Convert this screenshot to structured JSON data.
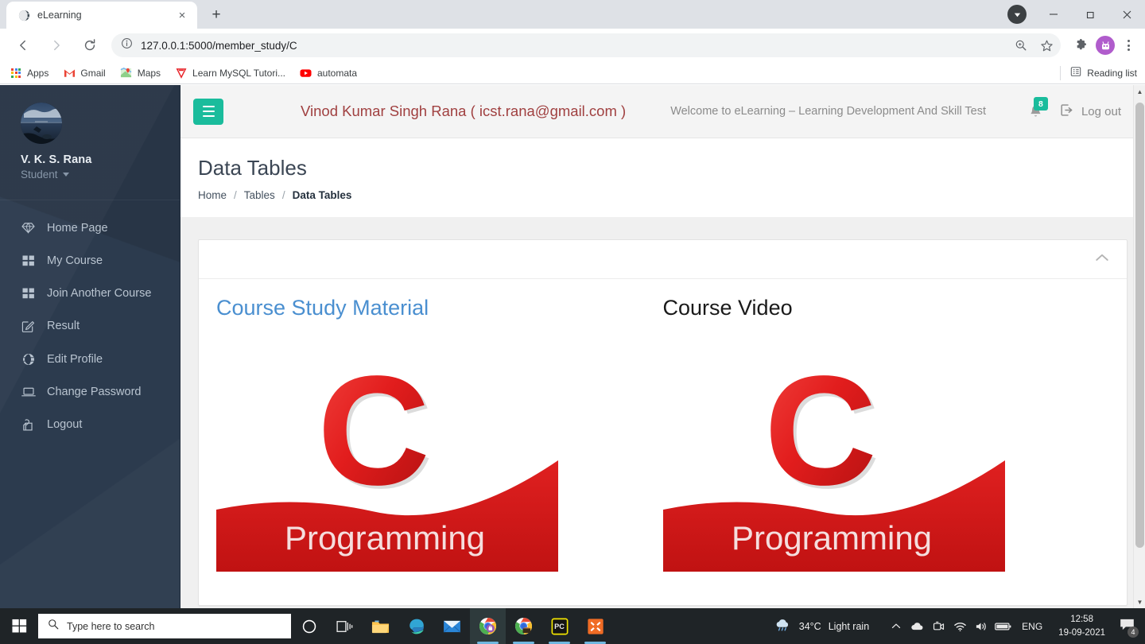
{
  "browser": {
    "tab": {
      "title": "eLearning",
      "favicon": "globe-icon",
      "close": "×"
    },
    "newtab_label": "+",
    "window_controls": {
      "minimize": "—",
      "maximize": "❐",
      "close": "✕"
    },
    "nav": {
      "back": "←",
      "forward": "→",
      "reload": "⟳"
    },
    "omnibox": {
      "url": "127.0.0.1:5000/member_study/C",
      "info_icon": "info-icon",
      "zoom_icon": "zoom-icon",
      "star_icon": "star-icon"
    },
    "extensions_icon": "puzzle-icon",
    "bookmarks": [
      {
        "label": "Apps",
        "icon": "apps-grid-icon"
      },
      {
        "label": "Gmail",
        "icon": "gmail-icon"
      },
      {
        "label": "Maps",
        "icon": "maps-icon"
      },
      {
        "label": "Learn MySQL Tutori...",
        "icon": "mysql-tutorial-icon"
      },
      {
        "label": "automata",
        "icon": "youtube-icon"
      }
    ],
    "reading_list": {
      "label": "Reading list",
      "icon": "reading-list-icon"
    }
  },
  "sidebar": {
    "user_name": "V. K. S. Rana",
    "role": "Student",
    "avatar_alt": "user-avatar",
    "items": [
      {
        "label": "Home Page",
        "icon": "diamond-icon"
      },
      {
        "label": "My Course",
        "icon": "grid-icon"
      },
      {
        "label": "Join Another Course",
        "icon": "grid-icon"
      },
      {
        "label": "Result",
        "icon": "edit-square-icon"
      },
      {
        "label": "Edit Profile",
        "icon": "globe-circle-icon"
      },
      {
        "label": "Change Password",
        "icon": "laptop-icon"
      },
      {
        "label": "Logout",
        "icon": "copy-icon"
      }
    ]
  },
  "topbar": {
    "menu_toggle": "hamburger-icon",
    "user_name": "Vinod Kumar Singh Rana",
    "user_email_wrapped": "(  icst.rana@gmail.com  )",
    "welcome": "Welcome to eLearning – Learning Development And Skill Test",
    "notification_count": "8",
    "logout_label": "Log out"
  },
  "page": {
    "title": "Data Tables",
    "breadcrumb": [
      {
        "label": "Home",
        "active": false
      },
      {
        "label": "Tables",
        "active": false
      },
      {
        "label": "Data Tables",
        "active": true
      }
    ],
    "separator": "/"
  },
  "card": {
    "collapse_icon": "chevron-up-icon",
    "columns": [
      {
        "title": "Course Study Material",
        "style": "link",
        "thumb_text": "Programming",
        "thumb_letter": "C"
      },
      {
        "title": "Course Video",
        "style": "plain",
        "thumb_text": "Programming",
        "thumb_letter": "C"
      }
    ]
  },
  "taskbar": {
    "start_icon": "windows-icon",
    "search_placeholder": "Type here to search",
    "search_icon": "search-icon",
    "icons": [
      {
        "name": "cortana-icon",
        "state": "idle"
      },
      {
        "name": "task-view-icon",
        "state": "idle"
      },
      {
        "name": "file-explorer-icon",
        "state": "idle"
      },
      {
        "name": "edge-icon",
        "state": "idle"
      },
      {
        "name": "mail-icon",
        "state": "idle"
      },
      {
        "name": "chrome-icon",
        "state": "active"
      },
      {
        "name": "chrome-icon",
        "state": "running"
      },
      {
        "name": "pycharm-icon",
        "state": "running"
      },
      {
        "name": "xampp-icon",
        "state": "running"
      }
    ],
    "weather": {
      "temperature": "34°C",
      "condition": "Light rain",
      "icon": "rain-cloud-icon"
    },
    "tray": [
      {
        "name": "show-hidden-icons",
        "glyph": "∧"
      },
      {
        "name": "onedrive-icon",
        "glyph": ""
      },
      {
        "name": "camera-icon",
        "glyph": ""
      },
      {
        "name": "wifi-icon",
        "glyph": ""
      },
      {
        "name": "volume-icon",
        "glyph": ""
      },
      {
        "name": "battery-icon",
        "glyph": ""
      }
    ],
    "language": "ENG",
    "time": "12:58",
    "date": "19-09-2021",
    "action_center_count": "4"
  },
  "colors": {
    "sidebar_bg": "#2c3b4e",
    "accent_teal": "#1abc9c",
    "user_name_red": "#a04040",
    "link_blue": "#4a8fd0",
    "logo_red": "#dd1f1f"
  }
}
